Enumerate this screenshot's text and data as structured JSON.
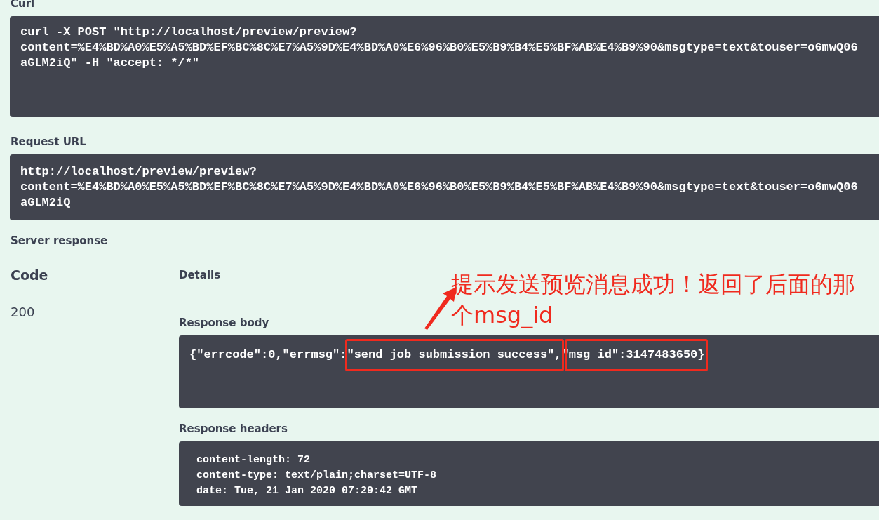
{
  "curl": {
    "label": "Curl",
    "lines": [
      "curl -X POST \"http://localhost/preview/preview?",
      "content=%E4%BD%A0%E5%A5%BD%EF%BC%8C%E7%A5%9D%E4%BD%A0%E6%96%B0%E5%B9%B4%E5%BF%AB%E4%B9%90&msgtype=text&touser=o6mwQ06",
      "aGLM2iQ\" -H \"accept: */*\""
    ]
  },
  "request_url": {
    "label": "Request URL",
    "lines": [
      "http://localhost/preview/preview?",
      "content=%E4%BD%A0%E5%A5%BD%EF%BC%8C%E7%A5%9D%E4%BD%A0%E6%96%B0%E5%B9%B4%E5%BF%AB%E4%B9%90&msgtype=text&touser=o6mwQ06",
      "aGLM2iQ"
    ]
  },
  "server_response": {
    "label": "Server response",
    "columns": [
      "Code",
      "Details"
    ],
    "code": "200",
    "response_body": {
      "label": "Response body",
      "text": "{\"errcode\":0,\"errmsg\":\"send job submission success\",\"msg_id\":3147483650}"
    },
    "response_headers": {
      "label": "Response headers",
      "lines": [
        "content-length: 72",
        "content-type: text/plain;charset=UTF-8",
        "date: Tue, 21 Jan 2020 07:29:42 GMT"
      ]
    }
  },
  "annotation": {
    "text": "提示发送预览消息成功！返回了后面的那个msg_id"
  }
}
